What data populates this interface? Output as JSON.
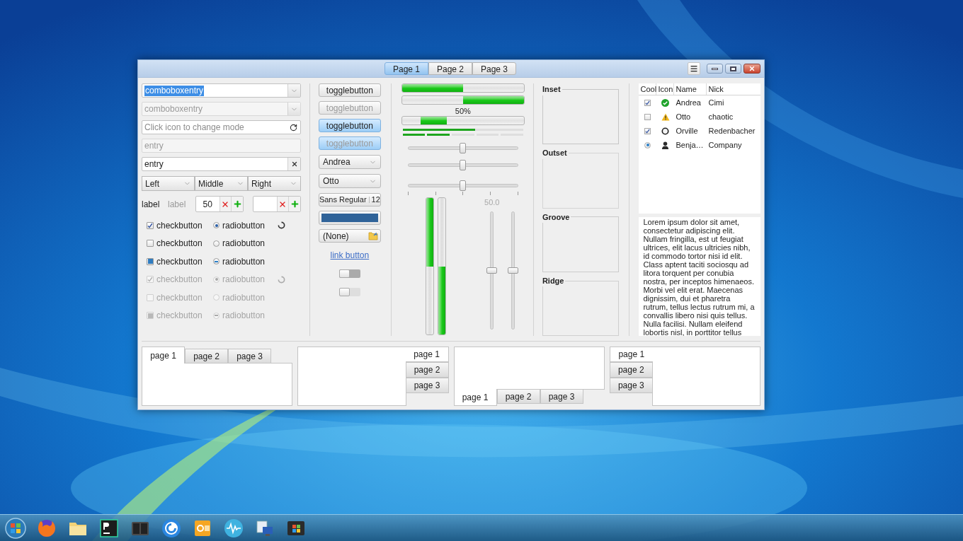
{
  "header_tabs": [
    {
      "label": "Page 1",
      "selected": true
    },
    {
      "label": "Page 2",
      "selected": false
    },
    {
      "label": "Page 3",
      "selected": false
    }
  ],
  "entries": [
    {
      "kind": "combo",
      "value": "comboboxentry",
      "text_selected": true,
      "disabled": false
    },
    {
      "kind": "combo",
      "value": "comboboxentry",
      "text_selected": false,
      "disabled": true
    },
    {
      "kind": "refresh",
      "placeholder": "Click icon to change mode",
      "text_selected": false,
      "disabled": false
    },
    {
      "kind": "plain",
      "value": "entry",
      "text_selected": false,
      "disabled": true
    },
    {
      "kind": "clear",
      "value": "entry",
      "text_selected": false,
      "disabled": false
    }
  ],
  "align_combos": [
    {
      "label": "Left"
    },
    {
      "label": "Middle"
    },
    {
      "label": "Right"
    }
  ],
  "labels": [
    {
      "text": "label",
      "disabled": false
    },
    {
      "text": "label",
      "disabled": true
    }
  ],
  "spinbuttons": [
    {
      "kind": "number",
      "value": "50"
    },
    {
      "kind": "blank"
    }
  ],
  "check_rows": [
    {
      "disabled": false,
      "spinner": true,
      "check": {
        "label": "checkbutton",
        "checked": true,
        "inconsistent": false
      },
      "radio": {
        "label": "radiobutton",
        "checked": true,
        "inconsistent": false
      }
    },
    {
      "disabled": false,
      "spinner": false,
      "check": {
        "label": "checkbutton",
        "checked": false,
        "inconsistent": false
      },
      "radio": {
        "label": "radiobutton",
        "checked": false,
        "inconsistent": false
      }
    },
    {
      "disabled": false,
      "spinner": false,
      "check": {
        "label": "checkbutton",
        "checked": false,
        "inconsistent": true
      },
      "radio": {
        "label": "radiobutton",
        "checked": false,
        "inconsistent": true
      }
    },
    {
      "disabled": true,
      "spinner": true,
      "check": {
        "label": "checkbutton",
        "checked": true,
        "inconsistent": false
      },
      "radio": {
        "label": "radiobutton",
        "checked": true,
        "inconsistent": false
      }
    },
    {
      "disabled": true,
      "spinner": false,
      "check": {
        "label": "checkbutton",
        "checked": false,
        "inconsistent": false
      },
      "radio": {
        "label": "radiobutton",
        "checked": false,
        "inconsistent": false
      }
    },
    {
      "disabled": true,
      "spinner": false,
      "check": {
        "label": "checkbutton",
        "checked": false,
        "inconsistent": true
      },
      "radio": {
        "label": "radiobutton",
        "checked": false,
        "inconsistent": true
      }
    }
  ],
  "toggle_buttons": [
    {
      "label": "togglebutton",
      "active": false,
      "disabled": false
    },
    {
      "label": "togglebutton",
      "active": false,
      "disabled": true
    },
    {
      "label": "togglebutton",
      "active": true,
      "disabled": false
    },
    {
      "label": "togglebutton",
      "active": true,
      "disabled": true
    }
  ],
  "combo_boxes": [
    {
      "value": "Andrea"
    },
    {
      "value": "Otto"
    }
  ],
  "font_button": {
    "family": "Sans Regular",
    "size": "12"
  },
  "color_button": {
    "color": "#2f6399"
  },
  "file_button": {
    "value": "(None)"
  },
  "link_button": {
    "label": "link button"
  },
  "switches": [
    {
      "on": false,
      "disabled": false
    },
    {
      "on": false,
      "disabled": true
    }
  ],
  "progress_bars": [
    {
      "kind": "normal",
      "level": 0.5
    },
    {
      "kind": "inverted",
      "level": 0.5
    },
    {
      "kind": "pulse",
      "text": "50%"
    }
  ],
  "level_bars": [
    {
      "kind": "continuous",
      "level": 0.6
    },
    {
      "kind": "discrete",
      "level": 0.4
    }
  ],
  "scales": [
    {
      "level": 0.5,
      "marks": false
    },
    {
      "level": 0.5,
      "marks": false
    },
    {
      "level": 0.5,
      "marks": true
    }
  ],
  "vertical_progress": [
    {
      "level": 0.5,
      "inverted": false
    },
    {
      "level": 0.5,
      "inverted": true
    }
  ],
  "vertical_scales": [
    {
      "level": 0.5,
      "value": "50.0"
    },
    {
      "level": 0.5
    }
  ],
  "frames": [
    {
      "label": "Inset",
      "kind": "inset"
    },
    {
      "label": "Outset",
      "kind": "outset"
    },
    {
      "label": "Groove",
      "kind": "groove"
    },
    {
      "label": "Ridge",
      "kind": "ridge"
    }
  ],
  "tree": {
    "columns": [
      "Cool",
      "Icon",
      "Name",
      "Nick"
    ],
    "rows": [
      {
        "cool": {
          "kind": "check",
          "checked": true
        },
        "kind": "ok",
        "name": "Andrea",
        "nick": "Cimi"
      },
      {
        "cool": {
          "kind": "check",
          "checked": false
        },
        "kind": "warning",
        "name": "Otto",
        "nick": "chaotic"
      },
      {
        "cool": {
          "kind": "check",
          "checked": true
        },
        "kind": "ring",
        "name": "Orville",
        "nick": "Redenbacher"
      },
      {
        "cool": {
          "kind": "radio",
          "checked": true
        },
        "kind": "person",
        "name": "Benja…",
        "nick": "Company"
      }
    ]
  },
  "text_view": {
    "paragraphs": [
      "Lorem ipsum dolor sit amet, consectetur adipiscing elit.",
      "Nullam fringilla, est ut feugiat ultrices, elit lacus ultricies nibh, id commodo tortor nisi id elit.",
      "Class aptent taciti sociosqu ad litora torquent per conubia nostra, per inceptos himenaeos.",
      "Morbi vel elit erat. Maecenas dignissim, dui et pharetra rutrum, tellus lectus rutrum mi, a convallis libero nisi quis tellus.",
      "Nulla facilisi. Nullam eleifend lobortis nisl, in porttitor tellus"
    ]
  },
  "notebooks": [
    {
      "kind": "top",
      "tabs": [
        {
          "label": "page 1",
          "selected": true
        },
        {
          "label": "page 2",
          "selected": false
        },
        {
          "label": "page 3",
          "selected": false
        }
      ]
    },
    {
      "kind": "right",
      "tabs": [
        {
          "label": "page 1",
          "selected": true
        },
        {
          "label": "page 2",
          "selected": false
        },
        {
          "label": "page 3",
          "selected": false
        }
      ]
    },
    {
      "kind": "bottom",
      "tabs": [
        {
          "label": "page 1",
          "selected": true
        },
        {
          "label": "page 2",
          "selected": false
        },
        {
          "label": "page 3",
          "selected": false
        }
      ]
    },
    {
      "kind": "left",
      "tabs": [
        {
          "label": "page 1",
          "selected": true
        },
        {
          "label": "page 2",
          "selected": false
        },
        {
          "label": "page 3",
          "selected": false
        }
      ]
    }
  ]
}
